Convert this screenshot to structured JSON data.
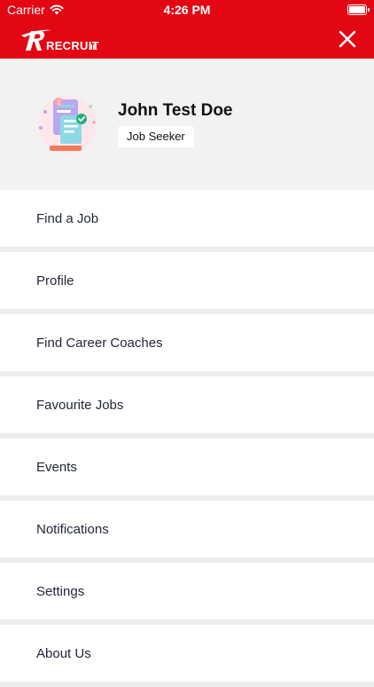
{
  "status_bar": {
    "carrier": "Carrier",
    "time": "4:26 PM",
    "wifi_icon": "wifi-icon",
    "battery_icon": "battery-icon"
  },
  "header": {
    "logo_text_main": "RECRUIT",
    "logo_text_suffix": ".IE",
    "close_icon": "close-icon",
    "brand_color": "#e30613"
  },
  "profile": {
    "name": "John Test Doe",
    "role": "Job Seeker",
    "avatar_icon": "job-seeker-illustration"
  },
  "menu": {
    "items": [
      {
        "label": "Find a Job"
      },
      {
        "label": "Profile"
      },
      {
        "label": "Find Career Coaches"
      },
      {
        "label": "Favourite Jobs"
      },
      {
        "label": "Events"
      },
      {
        "label": "Notifications"
      },
      {
        "label": "Settings"
      },
      {
        "label": "About Us"
      }
    ]
  }
}
